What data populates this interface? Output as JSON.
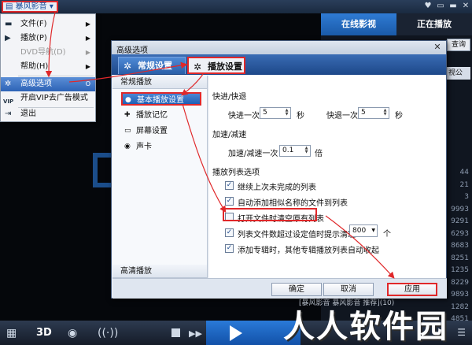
{
  "app": {
    "logo_label": "暴风影音",
    "win_controls": [
      "♥",
      "▭",
      "▬",
      "✕"
    ],
    "side_tabs": [
      "在线影视",
      "正在播放"
    ],
    "side_search": "查询",
    "side_select": "视公",
    "side_numbers": [
      "44",
      "21",
      "3",
      "9993",
      "9291",
      "6293",
      "8683",
      "8251",
      "1235",
      "8229",
      "9893",
      "1282",
      "4851"
    ],
    "bottom_caption": "[暴风影音 暴风影音 推荐](10)",
    "bottom_3d": "3D"
  },
  "context_menu": {
    "items": [
      {
        "label": "文件(F)",
        "icon": "folder-icon",
        "arrow": "▶",
        "disabled": false
      },
      {
        "label": "播放(P)",
        "icon": "play-icon",
        "arrow": "▶",
        "disabled": false
      },
      {
        "label": "DVD导航(D)",
        "icon": "",
        "arrow": "▶",
        "disabled": true
      },
      {
        "label": "帮助(H)",
        "icon": "",
        "arrow": "▶",
        "disabled": false
      },
      {
        "label": "高级选项",
        "icon": "gear-icon",
        "arrow": "O",
        "disabled": false,
        "active": true
      },
      {
        "label": "开启VIP去广告模式",
        "icon": "vip-icon",
        "arrow": "",
        "disabled": false
      },
      {
        "label": "退出",
        "icon": "exit-icon",
        "arrow": "",
        "disabled": false
      }
    ],
    "vip_badge": "VIP"
  },
  "dialog": {
    "title": "高级选项",
    "close": "✕",
    "tabs": [
      "常规设置",
      "播放设置"
    ],
    "side": {
      "group_top": "常规播放",
      "items": [
        "基本播放设置",
        "播放记忆",
        "屏幕设置",
        "声卡"
      ],
      "group_bottom": "高清播放"
    },
    "sections": {
      "seek": {
        "title": "快进/快退",
        "forward_label": "快进一次",
        "forward_value": "5",
        "back_label": "快退一次",
        "back_value": "5",
        "unit": "秒"
      },
      "speed": {
        "title": "加速/减速",
        "label": "加速/减速一次",
        "value": "0.1",
        "unit": "倍"
      },
      "playlist": {
        "title": "播放列表选项",
        "options": [
          {
            "label": "继续上次未完成的列表",
            "checked": true
          },
          {
            "label": "自动添加相似名称的文件到列表",
            "checked": true
          },
          {
            "label": "打开文件时清空原有列表",
            "checked": false
          },
          {
            "label": "列表文件数超过设定值时提示清理",
            "checked": true
          },
          {
            "label": "添加专辑时，其他专辑播放列表自动收起",
            "checked": true
          }
        ],
        "threshold_value": "800",
        "threshold_unit": "个"
      }
    },
    "buttons": {
      "ok": "确定",
      "cancel": "取消",
      "apply": "应用"
    }
  },
  "watermark": "人人软件园",
  "colors": {
    "annotation": "#e0282a",
    "accent": "#2d63b6"
  }
}
